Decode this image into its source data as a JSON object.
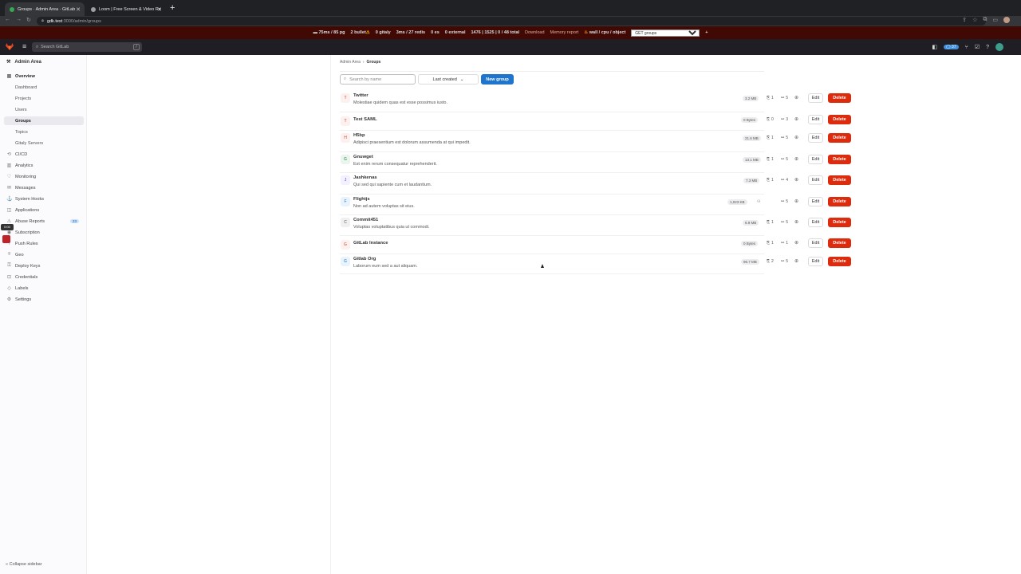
{
  "browser": {
    "tabs": [
      {
        "title": "Groups · Admin Area · GitLab",
        "active": true,
        "favicon_color": "#34a853"
      },
      {
        "title": "Loom | Free Screen & Video Re",
        "active": false,
        "favicon_color": "#9aa0a6"
      }
    ],
    "url_host": "gdk.test",
    "url_path": ":3000/admin/groups"
  },
  "perfbar": {
    "pg": "75ms / 85 pg",
    "bullet": "2 bullet",
    "gitaly": "0 gitaly",
    "redis": "3ms / 27 redis",
    "es": "0 es",
    "external": "0 external",
    "total": "1476 | 1525 | 0 / 48 total",
    "download": "Download",
    "memory": "Memory report",
    "flame": "wall / cpu / object",
    "select_value": "GET groups",
    "plus": "+"
  },
  "header": {
    "search_placeholder": "Search GitLab",
    "search_shortcut": "/",
    "mr_count": "37"
  },
  "sidebar": {
    "title": "Admin Area",
    "overview": "Overview",
    "sub": [
      "Dashboard",
      "Projects",
      "Users",
      "Groups",
      "Topics",
      "Gitaly Servers"
    ],
    "items": [
      "CI/CD",
      "Analytics",
      "Monitoring",
      "Messages",
      "System Hooks",
      "Applications",
      "Abuse Reports",
      "Subscription",
      "Push Rules",
      "Geo",
      "Deploy Keys",
      "Credentials",
      "Labels",
      "Settings"
    ],
    "abuse_badge": "23",
    "collapse": "Collapse sidebar",
    "loom_time": "0:00"
  },
  "breadcrumb": {
    "parent": "Admin Area",
    "current": "Groups"
  },
  "toolbar": {
    "filter_placeholder": "Search by name",
    "sort_label": "Last created",
    "new_group": "New group"
  },
  "groups": [
    {
      "initial": "T",
      "name": "Twitter",
      "desc": "Molestiae quidem quas est esse possimus iusto.",
      "size": "3.2 MB",
      "subgroups": "1",
      "members": "5",
      "avatar_bg": "#fcf1ef",
      "avatar_fg": "#c34a2a"
    },
    {
      "initial": "T",
      "name": "Test SAML",
      "desc": "",
      "size": "0 Bytes",
      "subgroups": "0",
      "members": "3",
      "avatar_bg": "#fcf1ef",
      "avatar_fg": "#c34a2a"
    },
    {
      "initial": "H",
      "name": "H5bp",
      "desc": "Adipisci praesentium est dolorum assumenda at qui impedit.",
      "size": "21.6 MB",
      "subgroups": "1",
      "members": "5",
      "avatar_bg": "#fcf1ef",
      "avatar_fg": "#c34a2a"
    },
    {
      "initial": "G",
      "name": "Gnuwget",
      "desc": "Est enim rerum consequatur reprehenderit.",
      "size": "13.1 MB",
      "subgroups": "1",
      "members": "5",
      "avatar_bg": "#ecf4ee",
      "avatar_fg": "#108548"
    },
    {
      "initial": "J",
      "name": "Jashkenas",
      "desc": "Qui sed qui sapiente cum et laudantium.",
      "size": "7.3 MB",
      "subgroups": "1",
      "members": "4",
      "avatar_bg": "#f4f0ff",
      "avatar_fg": "#5943b6"
    },
    {
      "initial": "F",
      "name": "Flightjs",
      "desc": "Non ad autem voluptas sit eius.",
      "size": "1,023 KB",
      "subgroups": "",
      "members": "5",
      "avatar_bg": "#e9f3fc",
      "avatar_fg": "#1f75cb"
    },
    {
      "initial": "C",
      "name": "Commit451",
      "desc": "Voluptas voluptatibus quia ut commodi.",
      "size": "6.9 MB",
      "subgroups": "1",
      "members": "5",
      "avatar_bg": "#f0f0f0",
      "avatar_fg": "#555555"
    },
    {
      "initial": "G",
      "name": "GitLab Instance",
      "desc": "",
      "size": "0 Bytes",
      "subgroups": "1",
      "members": "1",
      "avatar_bg": "#fcf1ef",
      "avatar_fg": "#c34a2a"
    },
    {
      "initial": "G",
      "name": "Gitlab Org",
      "desc": "Laborum eum sed a aut aliquam.",
      "size": "96.7 MB",
      "subgroups": "2",
      "members": "5",
      "avatar_bg": "#e9f3fc",
      "avatar_fg": "#1f75cb"
    }
  ],
  "actions": {
    "edit": "Edit",
    "delete": "Delete"
  },
  "colors": {
    "danger": "#dd2b0e",
    "confirm": "#1f75cb",
    "perfbar": "#410904",
    "header": "#1f1e24"
  }
}
